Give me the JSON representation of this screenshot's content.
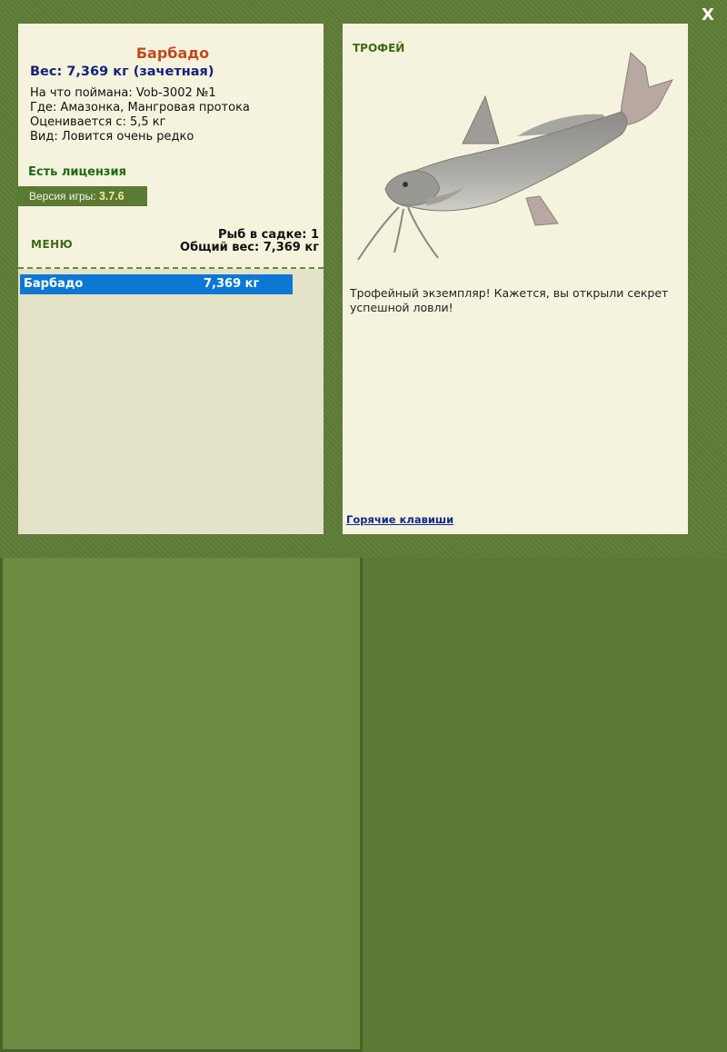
{
  "window": {
    "close_label": "X"
  },
  "fish": {
    "name": "Барбадо",
    "weight_line": "Вес: 7,369 кг (зачетная)",
    "caught_with": "На что поймана: Vob-3002 №1",
    "location": "Где: Амазонка, Мангровая протока",
    "valued_from": "Оценивается с: 5,5 кг",
    "kind": "Вид: Ловится очень редко"
  },
  "license": {
    "label": "Есть лицензия"
  },
  "version": {
    "prefix": "Версия игры:",
    "number": "3.7.6"
  },
  "menu": {
    "label": "МЕНЮ"
  },
  "keepnet": {
    "fish_count": "Рыб в садке: 1",
    "total_weight": "Общий вес: 7,369 кг",
    "rows": [
      {
        "name": "Барбадо",
        "weight": "7,369 кг"
      }
    ]
  },
  "trophy": {
    "label": "ТРОФЕЙ",
    "text": "Трофейный экземпляр! Кажется, вы открыли секрет успешной ловли!"
  },
  "footer": {
    "hotkeys": "Горячие клавиши"
  },
  "colors": {
    "background": "#5f7c37",
    "panel": "#f5f3dd",
    "fish_name": "#c24a1c",
    "weight": "#12237a",
    "license": "#1e6a12",
    "selection": "#0d78d4"
  },
  "icons": {
    "close": "close-icon",
    "fish": "catfish-image"
  }
}
